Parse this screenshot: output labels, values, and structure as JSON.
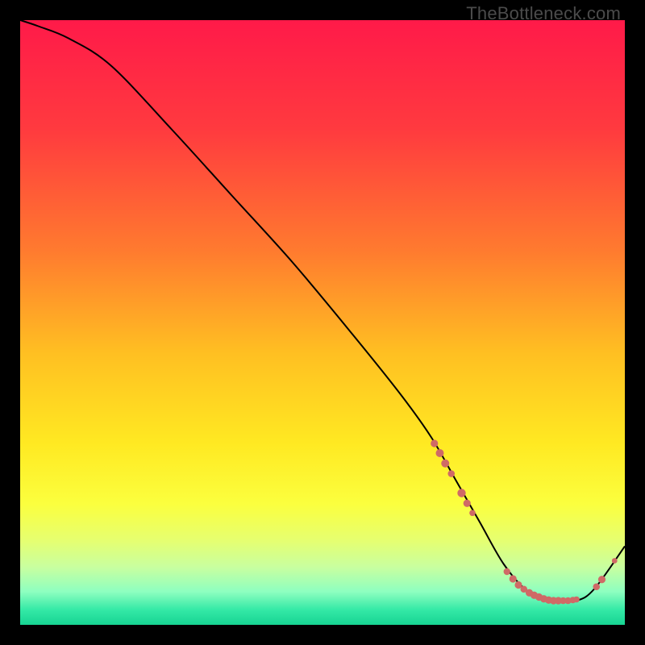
{
  "watermark": "TheBottleneck.com",
  "colors": {
    "black": "#000000",
    "curve": "#000000",
    "marker": "#cf6a66",
    "gradient_stops": [
      {
        "pos": 0.0,
        "color": "#ff1a49"
      },
      {
        "pos": 0.18,
        "color": "#ff3a3f"
      },
      {
        "pos": 0.38,
        "color": "#ff7a2f"
      },
      {
        "pos": 0.55,
        "color": "#ffbf22"
      },
      {
        "pos": 0.7,
        "color": "#ffe922"
      },
      {
        "pos": 0.8,
        "color": "#fbff3e"
      },
      {
        "pos": 0.86,
        "color": "#e6ff70"
      },
      {
        "pos": 0.905,
        "color": "#c8ffa0"
      },
      {
        "pos": 0.945,
        "color": "#8effc0"
      },
      {
        "pos": 0.975,
        "color": "#34e9a6"
      },
      {
        "pos": 1.0,
        "color": "#17d493"
      }
    ]
  },
  "chart_data": {
    "type": "line",
    "title": "",
    "xlabel": "",
    "ylabel": "",
    "xlim": [
      0,
      100
    ],
    "ylim": [
      0,
      100
    ],
    "series": [
      {
        "name": "bottleneck-curve",
        "x": [
          0,
          3,
          8,
          15,
          25,
          35,
          45,
          55,
          63,
          68,
          72,
          76,
          80,
          84,
          88,
          92,
          95,
          100
        ],
        "values": [
          100,
          99,
          97,
          92.5,
          82,
          71,
          60,
          48,
          38,
          31,
          24,
          17,
          10,
          5.5,
          4,
          4,
          6,
          13
        ]
      }
    ],
    "markers": [
      {
        "x": 68.5,
        "y": 30.0,
        "r": 4.6
      },
      {
        "x": 69.4,
        "y": 28.4,
        "r": 5.0
      },
      {
        "x": 70.3,
        "y": 26.7,
        "r": 5.0
      },
      {
        "x": 71.3,
        "y": 25.0,
        "r": 4.3
      },
      {
        "x": 73.0,
        "y": 21.8,
        "r": 5.2
      },
      {
        "x": 73.9,
        "y": 20.1,
        "r": 4.6
      },
      {
        "x": 74.8,
        "y": 18.5,
        "r": 3.8
      },
      {
        "x": 80.5,
        "y": 8.8,
        "r": 4.2
      },
      {
        "x": 81.5,
        "y": 7.6,
        "r": 4.6
      },
      {
        "x": 82.4,
        "y": 6.6,
        "r": 4.6
      },
      {
        "x": 83.3,
        "y": 5.9,
        "r": 4.3
      },
      {
        "x": 84.2,
        "y": 5.3,
        "r": 4.6
      },
      {
        "x": 85.0,
        "y": 4.9,
        "r": 4.6
      },
      {
        "x": 85.8,
        "y": 4.6,
        "r": 4.6
      },
      {
        "x": 86.6,
        "y": 4.3,
        "r": 4.6
      },
      {
        "x": 87.4,
        "y": 4.1,
        "r": 4.6
      },
      {
        "x": 88.2,
        "y": 4.0,
        "r": 4.6
      },
      {
        "x": 89.0,
        "y": 4.0,
        "r": 4.6
      },
      {
        "x": 89.8,
        "y": 4.0,
        "r": 4.3
      },
      {
        "x": 90.6,
        "y": 4.0,
        "r": 4.3
      },
      {
        "x": 91.4,
        "y": 4.1,
        "r": 4.0
      },
      {
        "x": 92.0,
        "y": 4.2,
        "r": 3.8
      },
      {
        "x": 95.3,
        "y": 6.3,
        "r": 4.3
      },
      {
        "x": 96.2,
        "y": 7.5,
        "r": 4.6
      },
      {
        "x": 98.3,
        "y": 10.6,
        "r": 3.4
      }
    ]
  }
}
